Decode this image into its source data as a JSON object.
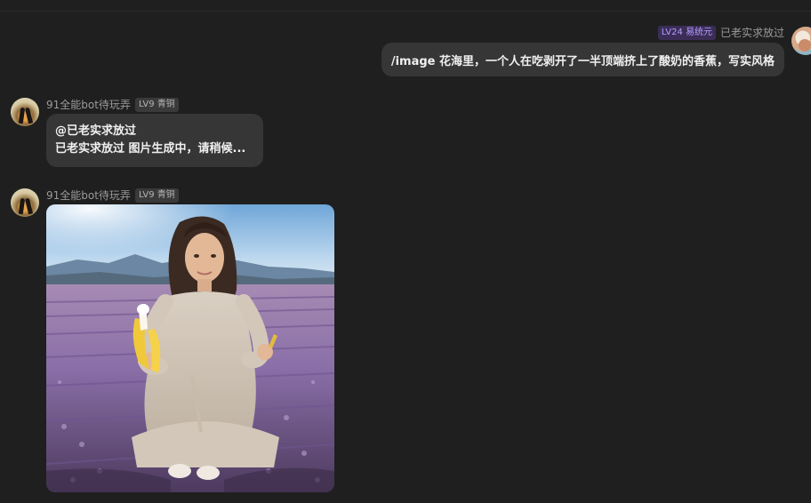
{
  "outgoing": {
    "level_badge": "LV24 易统元",
    "username": "已老实求放过",
    "message": "/image 花海里，一个人在吃剥开了一半顶端挤上了酸奶的香蕉，写实风格"
  },
  "bot": {
    "name": "91全能bot待玩弄",
    "level_badge": "LV9 青铜"
  },
  "reply": {
    "mention": "@已老实求放过",
    "status": "已老实求放过 图片生成中，请稍候..."
  },
  "colors": {
    "background": "#1f1f1f",
    "bubble": "#363636",
    "badge_purple": "#3a2e57",
    "badge_gray": "#3a3a3a"
  }
}
